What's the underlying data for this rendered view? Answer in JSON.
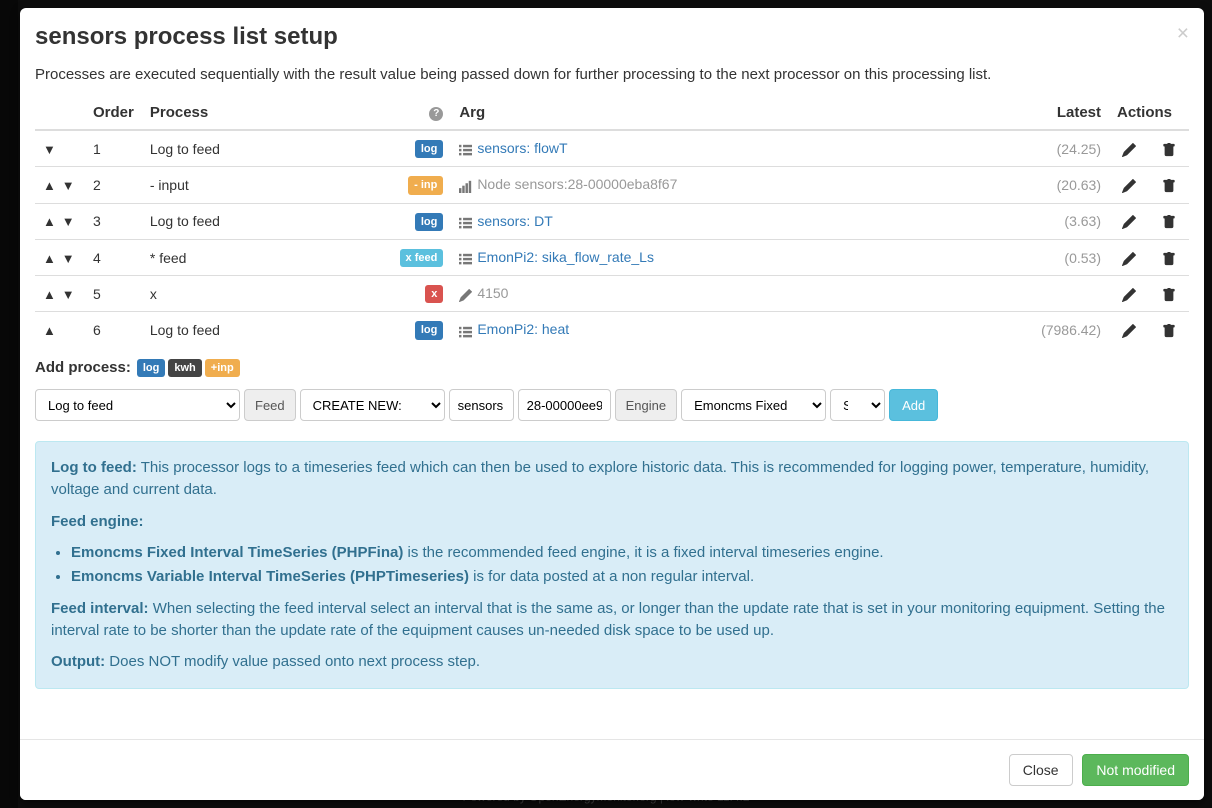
{
  "modal": {
    "title": "sensors process list setup",
    "intro": "Processes are executed sequentially with the result value being passed down for further processing to the next processor on this processing list."
  },
  "columns": {
    "arrows": "",
    "order": "Order",
    "process": "Process",
    "arg": "Arg",
    "latest": "Latest",
    "actions": "Actions"
  },
  "rows": [
    {
      "arrows": "down",
      "order": "1",
      "process": "Log to feed",
      "badge": {
        "text": "log",
        "cls": "badge-log"
      },
      "icon": "list",
      "arg": "sensors: flowT",
      "arg_link": true,
      "latest": "(24.25)"
    },
    {
      "arrows": "both",
      "order": "2",
      "process": "- input",
      "badge": {
        "text": "- inp",
        "cls": "badge-inp"
      },
      "icon": "signal",
      "arg": "Node sensors:28-00000eba8f67",
      "arg_link": false,
      "latest": "(20.63)"
    },
    {
      "arrows": "both",
      "order": "3",
      "process": "Log to feed",
      "badge": {
        "text": "log",
        "cls": "badge-log"
      },
      "icon": "list",
      "arg": "sensors: DT",
      "arg_link": true,
      "latest": "(3.63)"
    },
    {
      "arrows": "both",
      "order": "4",
      "process": "* feed",
      "badge": {
        "text": "x feed",
        "cls": "badge-xfeed"
      },
      "icon": "list",
      "arg": "EmonPi2: sika_flow_rate_Ls",
      "arg_link": true,
      "latest": "(0.53)"
    },
    {
      "arrows": "both",
      "order": "5",
      "process": "x",
      "badge": {
        "text": "x",
        "cls": "badge-x"
      },
      "icon": "edit",
      "arg": "4150",
      "arg_link": false,
      "latest": ""
    },
    {
      "arrows": "up",
      "order": "6",
      "process": "Log to feed",
      "badge": {
        "text": "log",
        "cls": "badge-log"
      },
      "icon": "list",
      "arg": "EmonPi2: heat",
      "arg_link": true,
      "latest": "(7986.42)"
    }
  ],
  "add_process": {
    "label": "Add process:",
    "badges": [
      {
        "text": "log",
        "cls": "badge-log"
      },
      {
        "text": "kwh",
        "cls": "badge-kwh"
      },
      {
        "text": "+inp",
        "cls": "badge-plusinp"
      }
    ]
  },
  "form": {
    "process_select": "Log to feed",
    "feed_label": "Feed",
    "feed_select": "CREATE NEW:",
    "tag_input": "sensors",
    "name_input": "28-00000ee9",
    "engine_label": "Engine",
    "engine_select": "Emoncms Fixed Inte",
    "interval_select": "Selec",
    "add_button": "Add"
  },
  "info": {
    "p1_b": "Log to feed:",
    "p1": " This processor logs to a timeseries feed which can then be used to explore historic data. This is recommended for logging power, temperature, humidity, voltage and current data.",
    "p2_b": "Feed engine:",
    "li1_b": "Emoncms Fixed Interval TimeSeries (PHPFina)",
    "li1": " is the recommended feed engine, it is a fixed interval timeseries engine.",
    "li2_b": "Emoncms Variable Interval TimeSeries (PHPTimeseries)",
    "li2": " is for data posted at a non regular interval.",
    "p3_b": "Feed interval:",
    "p3": " When selecting the feed interval select an interval that is the same as, or longer than the update rate that is set in your monitoring equipment. Setting the interval rate to be shorter than the update rate of the equipment causes un-needed disk space to be used up.",
    "p4_b": "Output:",
    "p4": " Does NOT modify value passed onto next process step."
  },
  "footer": {
    "close": "Close",
    "not_modified": "Not modified"
  },
  "page_footer": "Powered by OpenEnergyMonitor.org | low-write 11.4.2"
}
